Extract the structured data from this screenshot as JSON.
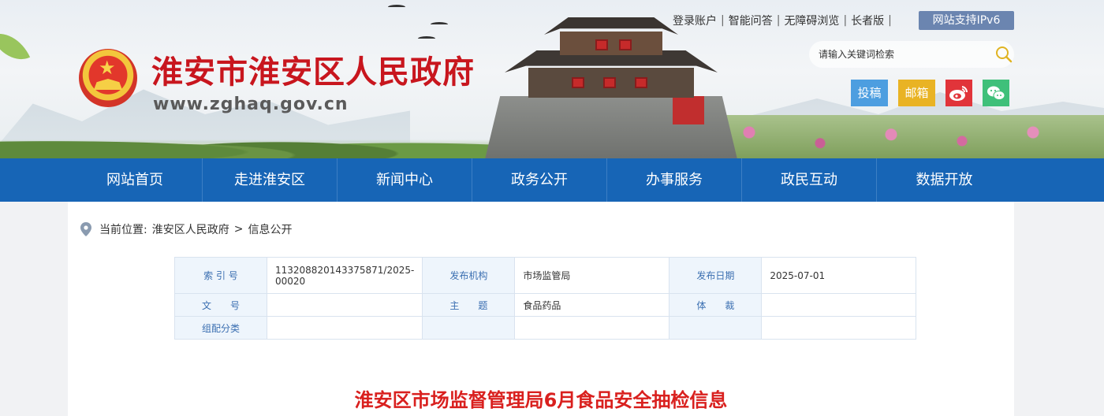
{
  "header": {
    "site_title": "淮安市淮安区人民政府",
    "site_url": "www.zghaq.gov.cn",
    "top_links": [
      "登录账户",
      "智能问答",
      "无障碍浏览",
      "长者版"
    ],
    "ipv6_badge": "网站支持IPv6",
    "search": {
      "placeholder": "请输入关键词检索"
    },
    "quick_buttons": {
      "tougao": "投稿",
      "youxiang": "邮箱"
    },
    "colors": {
      "title_red": "#c8161e",
      "nav_blue": "#1765b6"
    }
  },
  "nav": {
    "items": [
      "网站首页",
      "走进淮安区",
      "新闻中心",
      "政务公开",
      "办事服务",
      "政民互动",
      "数据开放"
    ]
  },
  "breadcrumb": {
    "label": "当前位置:",
    "items": [
      "淮安区人民政府",
      "信息公开"
    ],
    "separator": ">"
  },
  "meta_table": {
    "rows": [
      [
        {
          "label": "索 引 号",
          "value": "113208820143375871/2025-00020"
        },
        {
          "label": "发布机构",
          "value": "市场监管局"
        },
        {
          "label": "发布日期",
          "value": "2025-07-01"
        }
      ],
      [
        {
          "label": "文　　号",
          "value": ""
        },
        {
          "label": "主　　题",
          "value": "食品药品"
        },
        {
          "label": "体　　裁",
          "value": ""
        }
      ],
      [
        {
          "label": "组配分类",
          "value": ""
        },
        {
          "label": "",
          "value": ""
        },
        {
          "label": "",
          "value": ""
        }
      ]
    ]
  },
  "article": {
    "title": "淮安区市场监督管理局6月食品安全抽检信息"
  }
}
